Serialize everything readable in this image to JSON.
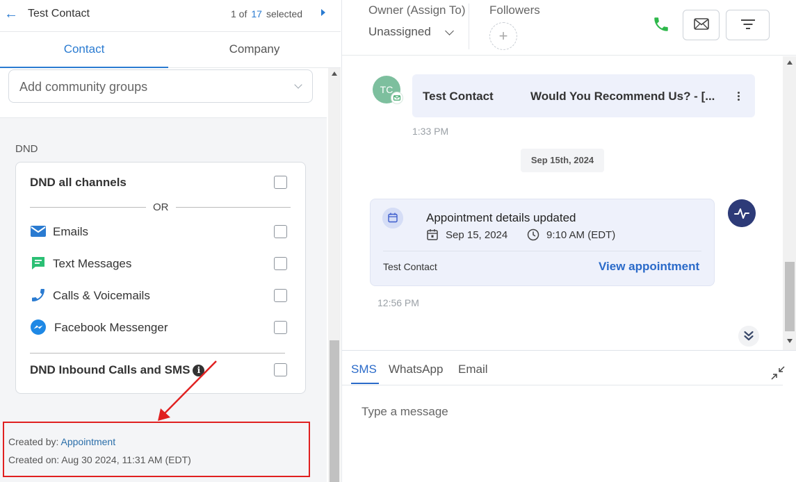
{
  "header": {
    "contact_name": "Test Contact",
    "pager_prefix": "1 of",
    "pager_count": "17",
    "pager_suffix": "selected"
  },
  "tabs": [
    {
      "label": "Contact",
      "active": true
    },
    {
      "label": "Company",
      "active": false
    }
  ],
  "community_groups": {
    "placeholder": "Add community groups"
  },
  "dnd": {
    "section_label": "DND",
    "all_channels_label": "DND all channels",
    "or_label": "OR",
    "channels": [
      {
        "label": "Emails",
        "icon": "email-icon"
      },
      {
        "label": "Text Messages",
        "icon": "sms-icon"
      },
      {
        "label": "Calls & Voicemails",
        "icon": "phone-icon"
      },
      {
        "label": "Facebook Messenger",
        "icon": "messenger-icon"
      }
    ],
    "inbound_label": "DND Inbound Calls and SMS"
  },
  "meta": {
    "created_by_label": "Created by:",
    "created_by_value": "Appointment",
    "created_on_label": "Created on:",
    "created_on_value": "Aug 30 2024, 11:31 AM (EDT)"
  },
  "conversation_header": {
    "owner_label": "Owner (Assign To)",
    "owner_value": "Unassigned",
    "followers_label": "Followers"
  },
  "feed": {
    "message": {
      "avatar_initials": "TC",
      "from": "Test Contact",
      "subject": "Would You Recommend Us?  -  [...",
      "time": "1:33 PM"
    },
    "date_divider": "Sep 15th, 2024",
    "appointment": {
      "title": "Appointment details updated",
      "date": "Sep 15, 2024",
      "time": "9:10 AM (EDT)",
      "contact": "Test Contact",
      "link": "View appointment",
      "timestamp": "12:56 PM"
    }
  },
  "composer": {
    "tabs": [
      {
        "label": "SMS",
        "active": true
      },
      {
        "label": "WhatsApp",
        "active": false
      },
      {
        "label": "Email",
        "active": false
      }
    ],
    "placeholder": "Type a message"
  },
  "colors": {
    "accent": "#2a7bd1",
    "highlight_box": "#e02020",
    "phone_green": "#2eb84b"
  }
}
